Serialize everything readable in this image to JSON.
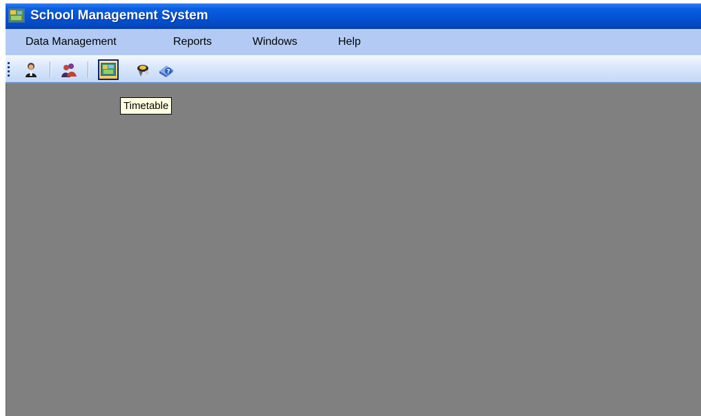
{
  "window": {
    "title": "School Management System",
    "title_bar_color": "#0454d8",
    "workspace_color": "#808080"
  },
  "menu": {
    "items": [
      {
        "label": "Data Management"
      },
      {
        "label": "Reports"
      },
      {
        "label": "Windows"
      },
      {
        "label": "Help"
      }
    ]
  },
  "toolbar": {
    "buttons": [
      {
        "icon": "user-icon",
        "active": false
      },
      {
        "icon": "people-icon",
        "active": false
      },
      {
        "icon": "timetable-icon",
        "active": true
      },
      {
        "icon": "exam-icon",
        "active": false
      },
      {
        "icon": "help-book-icon",
        "active": false
      }
    ]
  },
  "tooltip": {
    "text": "Timetable"
  }
}
